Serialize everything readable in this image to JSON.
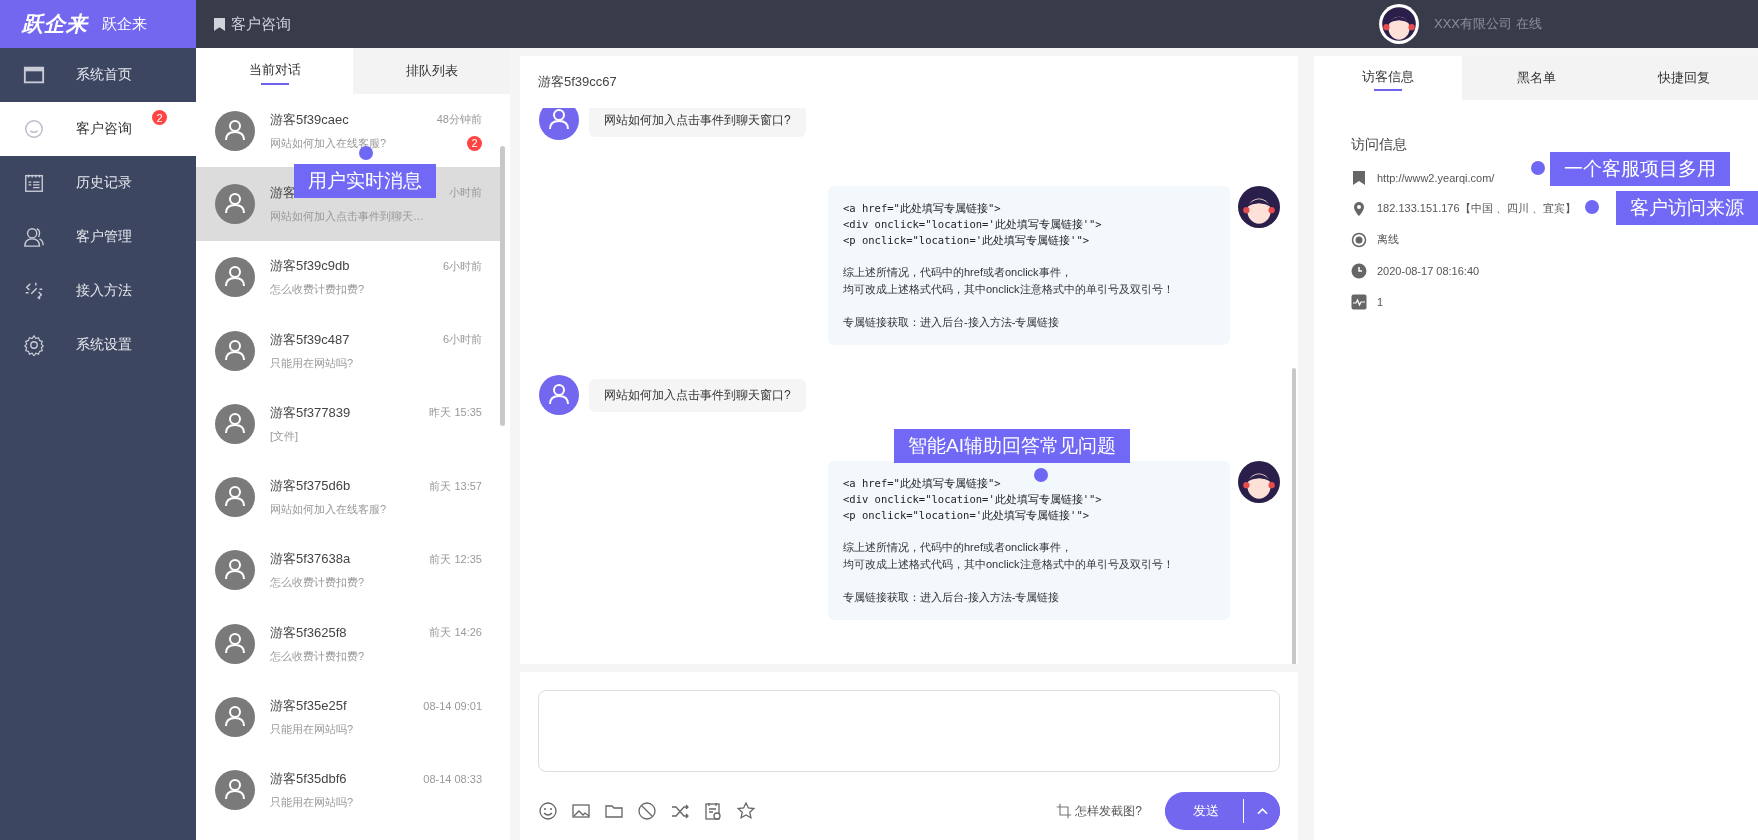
{
  "brand": {
    "logo": "跃企来",
    "name": "跃企来"
  },
  "header": {
    "title": "客户咨询",
    "account": "XXX有限公司 在线"
  },
  "nav": [
    {
      "label": "系统首页",
      "selected": false
    },
    {
      "label": "客户咨询",
      "selected": true,
      "badge": "2"
    },
    {
      "label": "历史记录",
      "selected": false
    },
    {
      "label": "客户管理",
      "selected": false
    },
    {
      "label": "接入方法",
      "selected": false
    },
    {
      "label": "系统设置",
      "selected": false
    }
  ],
  "list_tabs": [
    {
      "label": "当前对话",
      "selected": true
    },
    {
      "label": "排队列表",
      "selected": false
    }
  ],
  "conversations": [
    {
      "name": "游客5f39caec",
      "time": "48分钟前",
      "preview": "网站如何加入在线客服?",
      "badge": "2",
      "selected": false
    },
    {
      "name": "游客",
      "time": "小时前",
      "preview": "网站如何加入点击事件到聊天…",
      "selected": true
    },
    {
      "name": "游客5f39c9db",
      "time": "6小时前",
      "preview": "怎么收费计费扣费?",
      "selected": false
    },
    {
      "name": "游客5f39c487",
      "time": "6小时前",
      "preview": "只能用在网站吗?",
      "selected": false
    },
    {
      "name": "游客5f377839",
      "time": "昨天 15:35",
      "preview": "[文件]",
      "selected": false
    },
    {
      "name": "游客5f375d6b",
      "time": "前天 13:57",
      "preview": "网站如何加入在线客服?",
      "selected": false
    },
    {
      "name": "游客5f37638a",
      "time": "前天 12:35",
      "preview": "怎么收费计费扣费?",
      "selected": false
    },
    {
      "name": "游客5f3625f8",
      "time": "前天 14:26",
      "preview": "怎么收费计费扣费?",
      "selected": false
    },
    {
      "name": "游客5f35e25f",
      "time": "08-14 09:01",
      "preview": "只能用在网站吗?",
      "selected": false
    },
    {
      "name": "游客5f35dbf6",
      "time": "08-14 08:33",
      "preview": "只能用在网站吗?",
      "selected": false
    }
  ],
  "chat": {
    "title": "游客5f39cc67",
    "messages": [
      {
        "kind": "visitor",
        "text": "网站如何加入点击事件到聊天窗口?"
      },
      {
        "kind": "agent",
        "code": [
          "<a href=\"此处填写专属链接\">",
          "<div onclick=\"location='此处填写专属链接'\">",
          "<p onclick=\"location='此处填写专属链接'\">"
        ],
        "text": [
          "综上述所情况，代码中的href或者onclick事件，",
          "均可改成上述格式代码，其中onclick注意格式中的单引号及双引号！"
        ],
        "footer": "专属链接获取：进入后台-接入方法-专属链接"
      },
      {
        "kind": "visitor",
        "text": "网站如何加入点击事件到聊天窗口?"
      },
      {
        "kind": "agent",
        "code": [
          "<a href=\"此处填写专属链接\">",
          "<div onclick=\"location='此处填写专属链接'\">",
          "<p onclick=\"location='此处填写专属链接'\">"
        ],
        "text": [
          "综上述所情况，代码中的href或者onclick事件，",
          "均可改成上述格式代码，其中onclick注意格式中的单引号及双引号！"
        ],
        "footer": "专属链接获取：进入后台-接入方法-专属链接"
      }
    ]
  },
  "composer": {
    "screenshot_hint": "怎样发截图?",
    "send": "发送"
  },
  "right_tabs": [
    {
      "label": "访客信息",
      "selected": true
    },
    {
      "label": "黑名单",
      "selected": false
    },
    {
      "label": "快捷回复",
      "selected": false
    }
  ],
  "visit": {
    "heading": "访问信息",
    "rows": [
      {
        "text": "http://www2.yearqi.com/"
      },
      {
        "text": "182.133.151.176【中国 、四川 、宜宾】"
      },
      {
        "text": "离线"
      },
      {
        "text": "2020-08-17 08:16:40"
      },
      {
        "text": "1"
      }
    ]
  },
  "callouts": [
    {
      "text": "用户实时消息"
    },
    {
      "text": "智能AI辅助回答常见问题"
    },
    {
      "text": "一个客服项目多用"
    },
    {
      "text": "客户访问来源"
    }
  ]
}
